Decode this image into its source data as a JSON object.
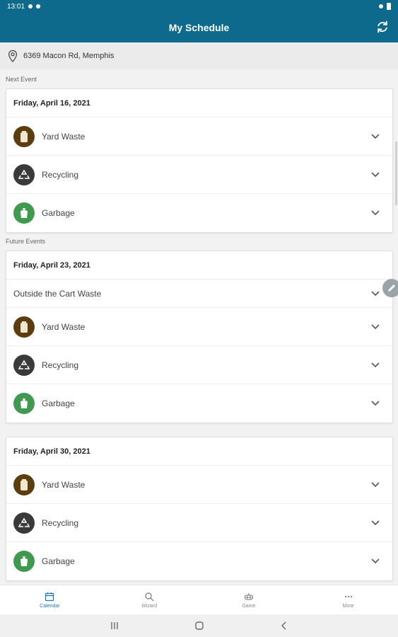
{
  "status_bar": {
    "time": "13:01"
  },
  "app_bar": {
    "title": "My Schedule"
  },
  "address": "6369 Macon Rd, Memphis",
  "next_event": {
    "label": "Next Event",
    "date": "Friday, April 16, 2021",
    "items": [
      {
        "label": "Yard Waste",
        "icon": "yard-waste-icon"
      },
      {
        "label": "Recycling",
        "icon": "recycling-icon"
      },
      {
        "label": "Garbage",
        "icon": "garbage-icon"
      }
    ]
  },
  "future_events": {
    "label": "Future Events",
    "events": [
      {
        "date": "Friday, April 23, 2021",
        "text_item": "Outside the Cart Waste",
        "items": [
          {
            "label": "Yard Waste",
            "icon": "yard-waste-icon"
          },
          {
            "label": "Recycling",
            "icon": "recycling-icon"
          },
          {
            "label": "Garbage",
            "icon": "garbage-icon"
          }
        ]
      },
      {
        "date": "Friday, April 30, 2021",
        "items": [
          {
            "label": "Yard Waste",
            "icon": "yard-waste-icon"
          },
          {
            "label": "Recycling",
            "icon": "recycling-icon"
          },
          {
            "label": "Garbage",
            "icon": "garbage-icon"
          }
        ]
      }
    ]
  },
  "bottom_nav": [
    {
      "label": "Calendar",
      "icon": "calendar-icon",
      "active": true
    },
    {
      "label": "Wizard",
      "icon": "search-icon",
      "active": false
    },
    {
      "label": "Game",
      "icon": "game-icon",
      "active": false
    },
    {
      "label": "More",
      "icon": "more-icon",
      "active": false
    }
  ],
  "colors": {
    "primary": "#0e6a8c",
    "yard": "#5c3d10",
    "recycle": "#3a3a3a",
    "garbage": "#3f9a4f",
    "nav_active": "#1f78b4"
  }
}
